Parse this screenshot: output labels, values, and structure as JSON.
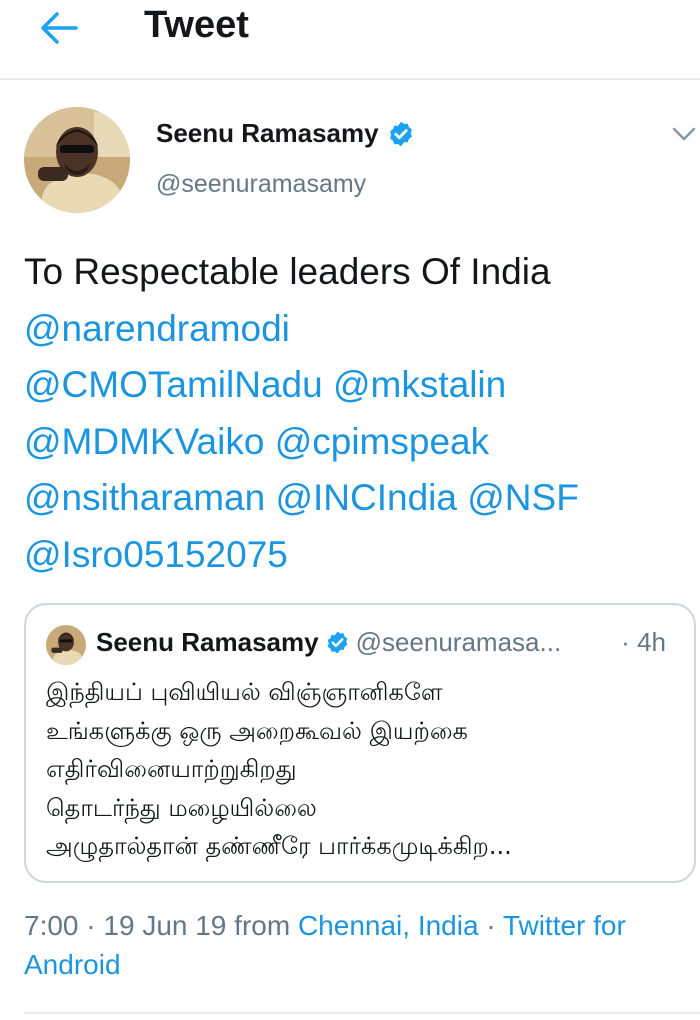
{
  "header": {
    "title": "Tweet",
    "back_icon": "arrow-left-icon",
    "accent_color": "#1da1f2"
  },
  "tweet": {
    "author": {
      "name": "Seenu Ramasamy",
      "handle": "@seenuramasamy",
      "verified": true
    },
    "text_intro": "To Respectable leaders Of India",
    "mentions": [
      "@narendramodi",
      "@CMOTamilNadu",
      "@mkstalin",
      "@MDMKVaiko",
      "@cpimspeak",
      "@nsitharaman",
      "@INCIndia",
      "@NSF",
      "@Isro05152075"
    ],
    "quoted": {
      "name": "Seenu Ramasamy",
      "handle": "@seenuramasa...",
      "separator": "·",
      "time": "4h",
      "text": "இந்தியப் புவியியல் விஞ்ஞானிகளே\nஉங்களுக்கு ஒரு அறைகூவல் இயற்கை\nஎதிர்வினையாற்றுகிறது\nதொடர்ந்து மழையில்லை\nஅழுதால்தான் தண்ணீரே பார்க்கமுடிக்கிற..."
    },
    "meta": {
      "time": "7:00",
      "sep1": "·",
      "date": "19 Jun 19",
      "from_label": "from",
      "location": "Chennai, India",
      "sep2": "·",
      "source": "Twitter for Android"
    }
  },
  "colors": {
    "link": "#1b95e0",
    "secondary_text": "#657786",
    "border": "#ccd6dd",
    "verified_badge": "#1da1f2"
  }
}
